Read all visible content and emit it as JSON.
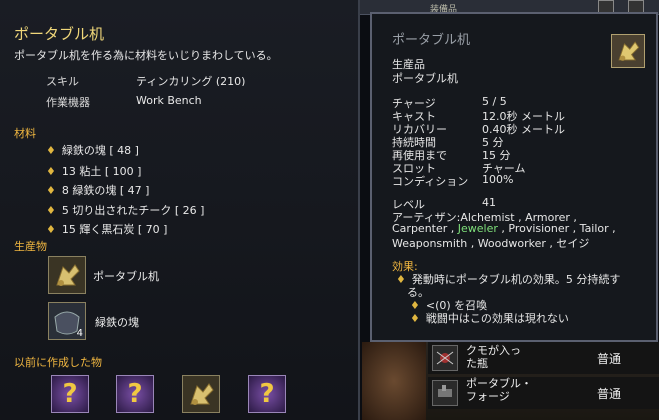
{
  "window": {
    "top_caption": "装備品"
  },
  "left": {
    "title": "ポータブル机",
    "description": "ポータブル机を作る為に材料をいじりまわしている。",
    "skill_label": "スキル",
    "skill_value": "ティンカリング (210)",
    "device_label": "作業機器",
    "device_value": "Work Bench",
    "materials_header": "材料",
    "materials": [
      "緑鉄の塊 [ 48 ]",
      "13 粘土 [ 100 ]",
      "8 緑鉄の塊 [ 47 ]",
      "5 切り出されたチーク [ 26 ]",
      "15 輝く黒石炭 [ 70 ]"
    ],
    "products_header": "生産物",
    "products": [
      {
        "name": "ポータブル机",
        "icon": "portable-desk-icon",
        "count": ""
      },
      {
        "name": "緑鉄の塊",
        "icon": "green-iron-chunk-icon",
        "count": "4"
      }
    ],
    "previous_header": "以前に作成した物",
    "previous_items": [
      "unknown-item-icon",
      "unknown-item-icon",
      "portable-desk-icon",
      "unknown-item-icon"
    ],
    "unknown_mark": "?"
  },
  "tooltip": {
    "title": "ポータブル机",
    "category": "生産品",
    "item_name": "ポータブル机",
    "stats": [
      {
        "label": "チャージ",
        "value": "5 / 5"
      },
      {
        "label": "キャスト",
        "value": "12.0秒 メートル"
      },
      {
        "label": "リカバリー",
        "value": "0.40秒 メートル"
      },
      {
        "label": "持続時間",
        "value": "5 分"
      },
      {
        "label": "再使用まで",
        "value": "15 分"
      },
      {
        "label": "スロット",
        "value": "チャーム"
      },
      {
        "label": "コンディション",
        "value": "100%"
      }
    ],
    "level_label": "レベル",
    "level_value": "41",
    "artisan_prefix": "アーティザン:",
    "artisan_line1": "Alchemist   , Armorer  ,",
    "artisan_line2a": "Carpenter  , ",
    "artisan_jeweler": "Jeweler",
    "artisan_line2b": " , Provisioner , Tailor ,",
    "artisan_line3": "Weaponsmith , Woodworker , セイジ",
    "effects_header": "効果:",
    "effect_main_1": "発動時にポータブル机の効果。5 分持続す",
    "effect_main_2": "る。",
    "effect_sub_1": "<(0) を召喚",
    "effect_sub_2": "戦闘中はこの効果は現れない"
  },
  "list": {
    "rows": [
      {
        "name_1": "クモが入っ",
        "name_2": "た瓶",
        "grade": "普通",
        "icon": "spider-jar-icon"
      },
      {
        "name_1": "ポータブル・",
        "name_2": "フォージ",
        "grade": "普通",
        "icon": "portable-forge-icon"
      }
    ]
  },
  "colors": {
    "title_gold": "#f0d77a",
    "section_orange": "#f0b640",
    "green": "#7fe07a",
    "cyan": "#6fd7e0"
  }
}
